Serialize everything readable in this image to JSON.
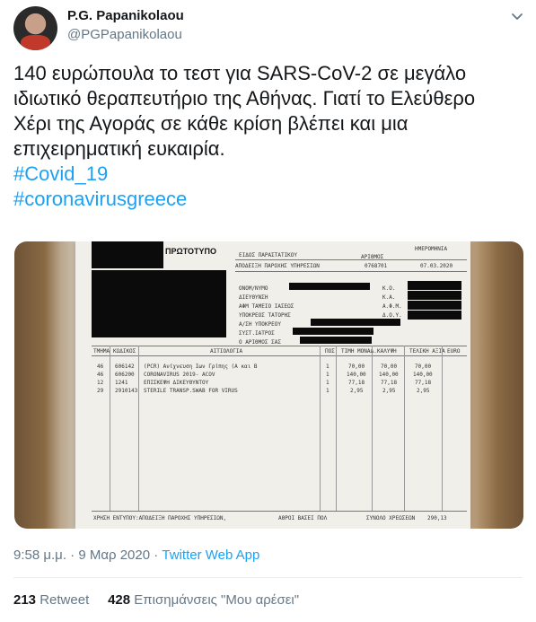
{
  "author": {
    "display_name": "P.G. Papanikolaou",
    "handle": "@PGPapanikolaou"
  },
  "tweet": {
    "lines": [
      "140 ευρώπουλα το τεστ για SARS-CoV-2 σε μεγάλο",
      "ιδιωτικό θεραπευτήριο της Αθήνας. Γιατί το Ελεύθερο",
      "Χέρι της Αγοράς σε κάθε κρίση βλέπει και μια",
      "επιχειρηματική ευκαιρία."
    ],
    "hashtags": [
      "#Covid_19",
      "#coronavirusgreece"
    ]
  },
  "receipt": {
    "original_label": "ΠΡΩΤΟΤΥΠΟ",
    "doc_type": "ΕΙΔΟΣ ΠΑΡΑΣΤΑΤΙΚΟΥ",
    "doc_desc": "ΑΠΟΔΕΙΞΗ ΠΑΡΟΧΗΣ ΥΠΗΡΕΣΙΩΝ",
    "number_label": "ΑΡΙΘΜΟΣ",
    "number": "0768701",
    "date_label": "ΗΜΕΡΟΜΗΝΙΑ",
    "date": "07.03.2020",
    "fields_left": [
      "ΟΝΟΜ/ΝΥΜΟ",
      "ΔΙΕΥΘΥΝΣΗ",
      "ΑΦΜ ΤΑΜΕΙΟ ΙΑΣΕΩΣ",
      "ΥΠΟΚΡΕΟΣ ΤΑΤΟΡΗΣ",
      "Α/ΣΗ ΥΠΟΚΡΕΟΥ",
      "ΣΥΣΤ.ΙΑΤΡΟΣ",
      "Ο ΑΡΙΘΜΟΣ ΣΑΣ"
    ],
    "fields_right": [
      "Κ.Ο.",
      "Κ.Α.",
      "Α.Φ.Μ.",
      "Δ.Ο.Υ."
    ],
    "columns": [
      "ΤΜΗΜΑ",
      "ΚΩΔΙΚΟΣ",
      "ΑΙΤΙΟΛΟΓΙΑ",
      "ΠΟΣ.",
      "ΤΙΜΗ ΜΟΝΑΔ.",
      "ΚΑΛΥΨΗ",
      "ΤΕΛΙΚΗ ΑΞΙΑ",
      "EURO"
    ],
    "rows": [
      [
        "46",
        "606142",
        "(PCR) Ανίχνευση Ιων Γρίπης (Α και Β",
        "1",
        "70,00",
        "70,00",
        "70,00"
      ],
      [
        "46",
        "606200",
        "CORONAVIRUS 2019- ΑCOV",
        "1",
        "140,00",
        "140,00",
        "140,00"
      ],
      [
        "12",
        "1241",
        "ΕΠΙΣΚΕΨΗ ΔΙΚΕΥΘΥΝΤΟΥ",
        "1",
        "77,18",
        "77,18",
        "77,18"
      ],
      [
        "29",
        "2910143",
        "STERILE TRANSP.SWAB FOR VIRUS",
        "1",
        "2,95",
        "2,95",
        "2,95"
      ]
    ],
    "footer_left": "ΧΡΗΣΗ ΕΝΤΥΠΟΥ:ΑΠΟΔΕΙΞΗ ΠΑΡΟΧΗΣ ΥΠΗΡΕΣΙΩΝ,",
    "footer_mid": "ΑΘΡΟΙ  ΒΑΣΕΙ ΠΟΛ",
    "footer_total_label": "ΣΥΝΟΛΟ ΧΡΕΩΣΕΩΝ",
    "footer_total": "290,13"
  },
  "meta": {
    "time": "9:58 μ.μ.",
    "sep": "·",
    "date": "9 Μαρ 2020",
    "source": "Twitter Web App"
  },
  "stats": {
    "retweets": "213",
    "retweets_label": "Retweet",
    "likes": "428",
    "likes_label": "Επισημάνσεις \"Μου αρέσει\""
  }
}
